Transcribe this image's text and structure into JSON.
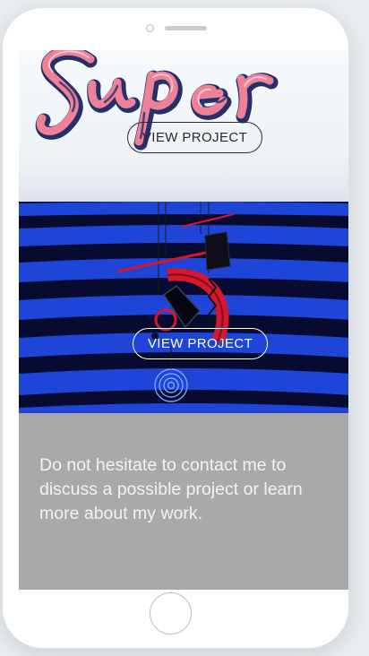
{
  "projects": [
    {
      "id": "super",
      "image_text": "Super",
      "button_label": "VIEW PROJECT"
    },
    {
      "id": "stripes",
      "button_label": "VIEW PROJECT"
    }
  ],
  "contact": {
    "message": "Do not hesitate to contact me to discuss a possible project or learn more about my work."
  },
  "colors": {
    "contact_background": "#a9a9a9",
    "stripe_blue": "#1f45d8",
    "stripe_navy": "#070b30",
    "accent_red": "#d7172c",
    "lettering_pink": "#ee8098",
    "lettering_navy": "#25306b"
  }
}
